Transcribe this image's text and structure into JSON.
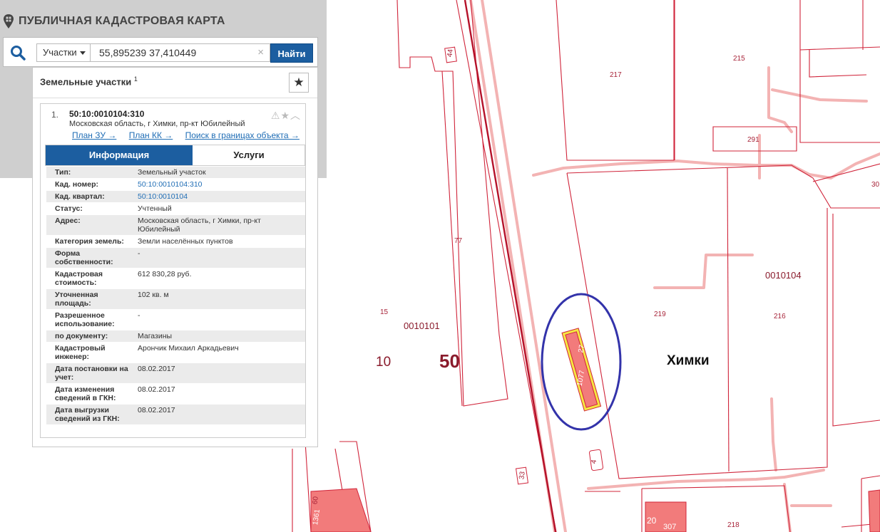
{
  "app": {
    "title": "ПУБЛИЧНАЯ КАДАСТРОВАЯ КАРТА",
    "logo_icon": "map-pin-icon"
  },
  "search": {
    "type_label": "Участки",
    "query": "55,895239 37,410449",
    "clear_symbol": "×",
    "submit_label": "Найти",
    "accent_color": "#1c5ea0"
  },
  "results": {
    "title": "Земельные участки",
    "count": "1",
    "favorite_icon": "star-icon",
    "item": {
      "index": "1.",
      "cad_number": "50:10:0010104:310",
      "address": "Московская область, г Химки, пр-кт Юбилейный",
      "links": [
        "План ЗУ →",
        "План КК →",
        "Поиск в границах объекта →"
      ],
      "tabs": [
        "Информация",
        "Услуги"
      ],
      "fields": [
        {
          "key": "Тип:",
          "value": "Земельный участок"
        },
        {
          "key": "Кад. номер:",
          "value": "50:10:0010104:310",
          "link": true
        },
        {
          "key": "Кад. квартал:",
          "value": "50:10:0010104",
          "link": true
        },
        {
          "key": "Статус:",
          "value": "Учтенный"
        },
        {
          "key": "Адрес:",
          "value": "Московская область, г Химки, пр-кт Юбилейный"
        },
        {
          "key": "Категория земель:",
          "value": "Земли населённых пунктов"
        },
        {
          "key": "Форма собственности:",
          "value": "-"
        },
        {
          "key": "Кадастровая стоимость:",
          "value": "612 830,28 руб."
        },
        {
          "key": "Уточненная площадь:",
          "value": "102 кв. м"
        },
        {
          "key": "Разрешенное использование:",
          "value": "-"
        },
        {
          "key": "по документу:",
          "value": "Магазины"
        },
        {
          "key": "Кадастровый инженер:",
          "value": "Арончик Михаил Аркадьевич"
        },
        {
          "key": "Дата постановки на учет:",
          "value": "08.02.2017"
        },
        {
          "key": "Дата изменения сведений в ГКН:",
          "value": "08.02.2017"
        },
        {
          "key": "Дата выгрузки сведений из ГКН:",
          "value": "08.02.2017"
        }
      ]
    }
  },
  "map": {
    "line_color": "#d0243a",
    "fill_color": "#f27b7b",
    "highlight_color": "#f5e642",
    "circle_color": "#3333aa",
    "labels": {
      "l44": "44",
      "l217": "217",
      "l215": "215",
      "l291": "291",
      "l30": "30",
      "l77": "77",
      "l15": "15",
      "l0010101": "0010101",
      "l10": "10",
      "l50": "50",
      "l0010104": "0010104",
      "l219": "219",
      "l216": "216",
      "city": "Химки",
      "l27": "27",
      "l1077": "1077",
      "l4": "4",
      "l33": "33",
      "l60": "60",
      "l1361": "1361",
      "l20": "20",
      "l307": "307",
      "l218": "218"
    }
  }
}
